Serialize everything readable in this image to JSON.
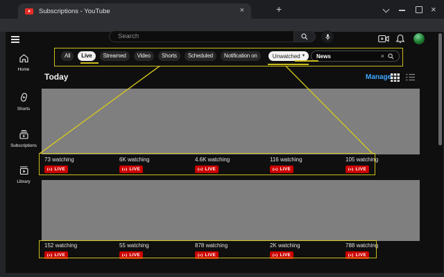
{
  "window": {
    "tab_title": "Subscriptions - YouTube",
    "url_domain": "youtube.com",
    "url_path": "/feed/subscriptions"
  },
  "glyphs": {
    "back": "←",
    "forward": "→",
    "reload": "↻",
    "new_tab": "+",
    "tab_close": "×",
    "window_close": "×",
    "kebab": "⋮",
    "star": "★",
    "caret_down": "▾",
    "clear": "×"
  },
  "masthead": {
    "search_placeholder": "Search"
  },
  "sidebar": {
    "items": [
      {
        "label": "Home"
      },
      {
        "label": "Shorts"
      },
      {
        "label": "Subscriptions"
      },
      {
        "label": "Library"
      }
    ]
  },
  "filters": {
    "chips": [
      {
        "label": "All"
      },
      {
        "label": "Live"
      },
      {
        "label": "Streamed"
      },
      {
        "label": "Video"
      },
      {
        "label": "Shorts"
      },
      {
        "label": "Scheduled"
      },
      {
        "label": "Notification on"
      }
    ],
    "active_chip": "Live",
    "dropdown_value": "Unwatched",
    "search_value": "News"
  },
  "content": {
    "section_title": "Today",
    "manage_label": "Manage",
    "live_badge": "LIVE",
    "rows": [
      {
        "items": [
          {
            "watching": "73 watching"
          },
          {
            "watching": "6K watching"
          },
          {
            "watching": "4.6K watching"
          },
          {
            "watching": "116 watching"
          },
          {
            "watching": "105 watching"
          }
        ]
      },
      {
        "items": [
          {
            "watching": "152 watching"
          },
          {
            "watching": "55 watching"
          },
          {
            "watching": "878 watching"
          },
          {
            "watching": "2K watching"
          },
          {
            "watching": "788 watching"
          }
        ]
      }
    ]
  },
  "colors": {
    "annotation_yellow": "#d9c91e",
    "live_red": "#cc0000",
    "link_blue": "#3ea6ff",
    "page_bg": "#0f0f0f",
    "active_chip_bg": "#f1f1f1"
  }
}
